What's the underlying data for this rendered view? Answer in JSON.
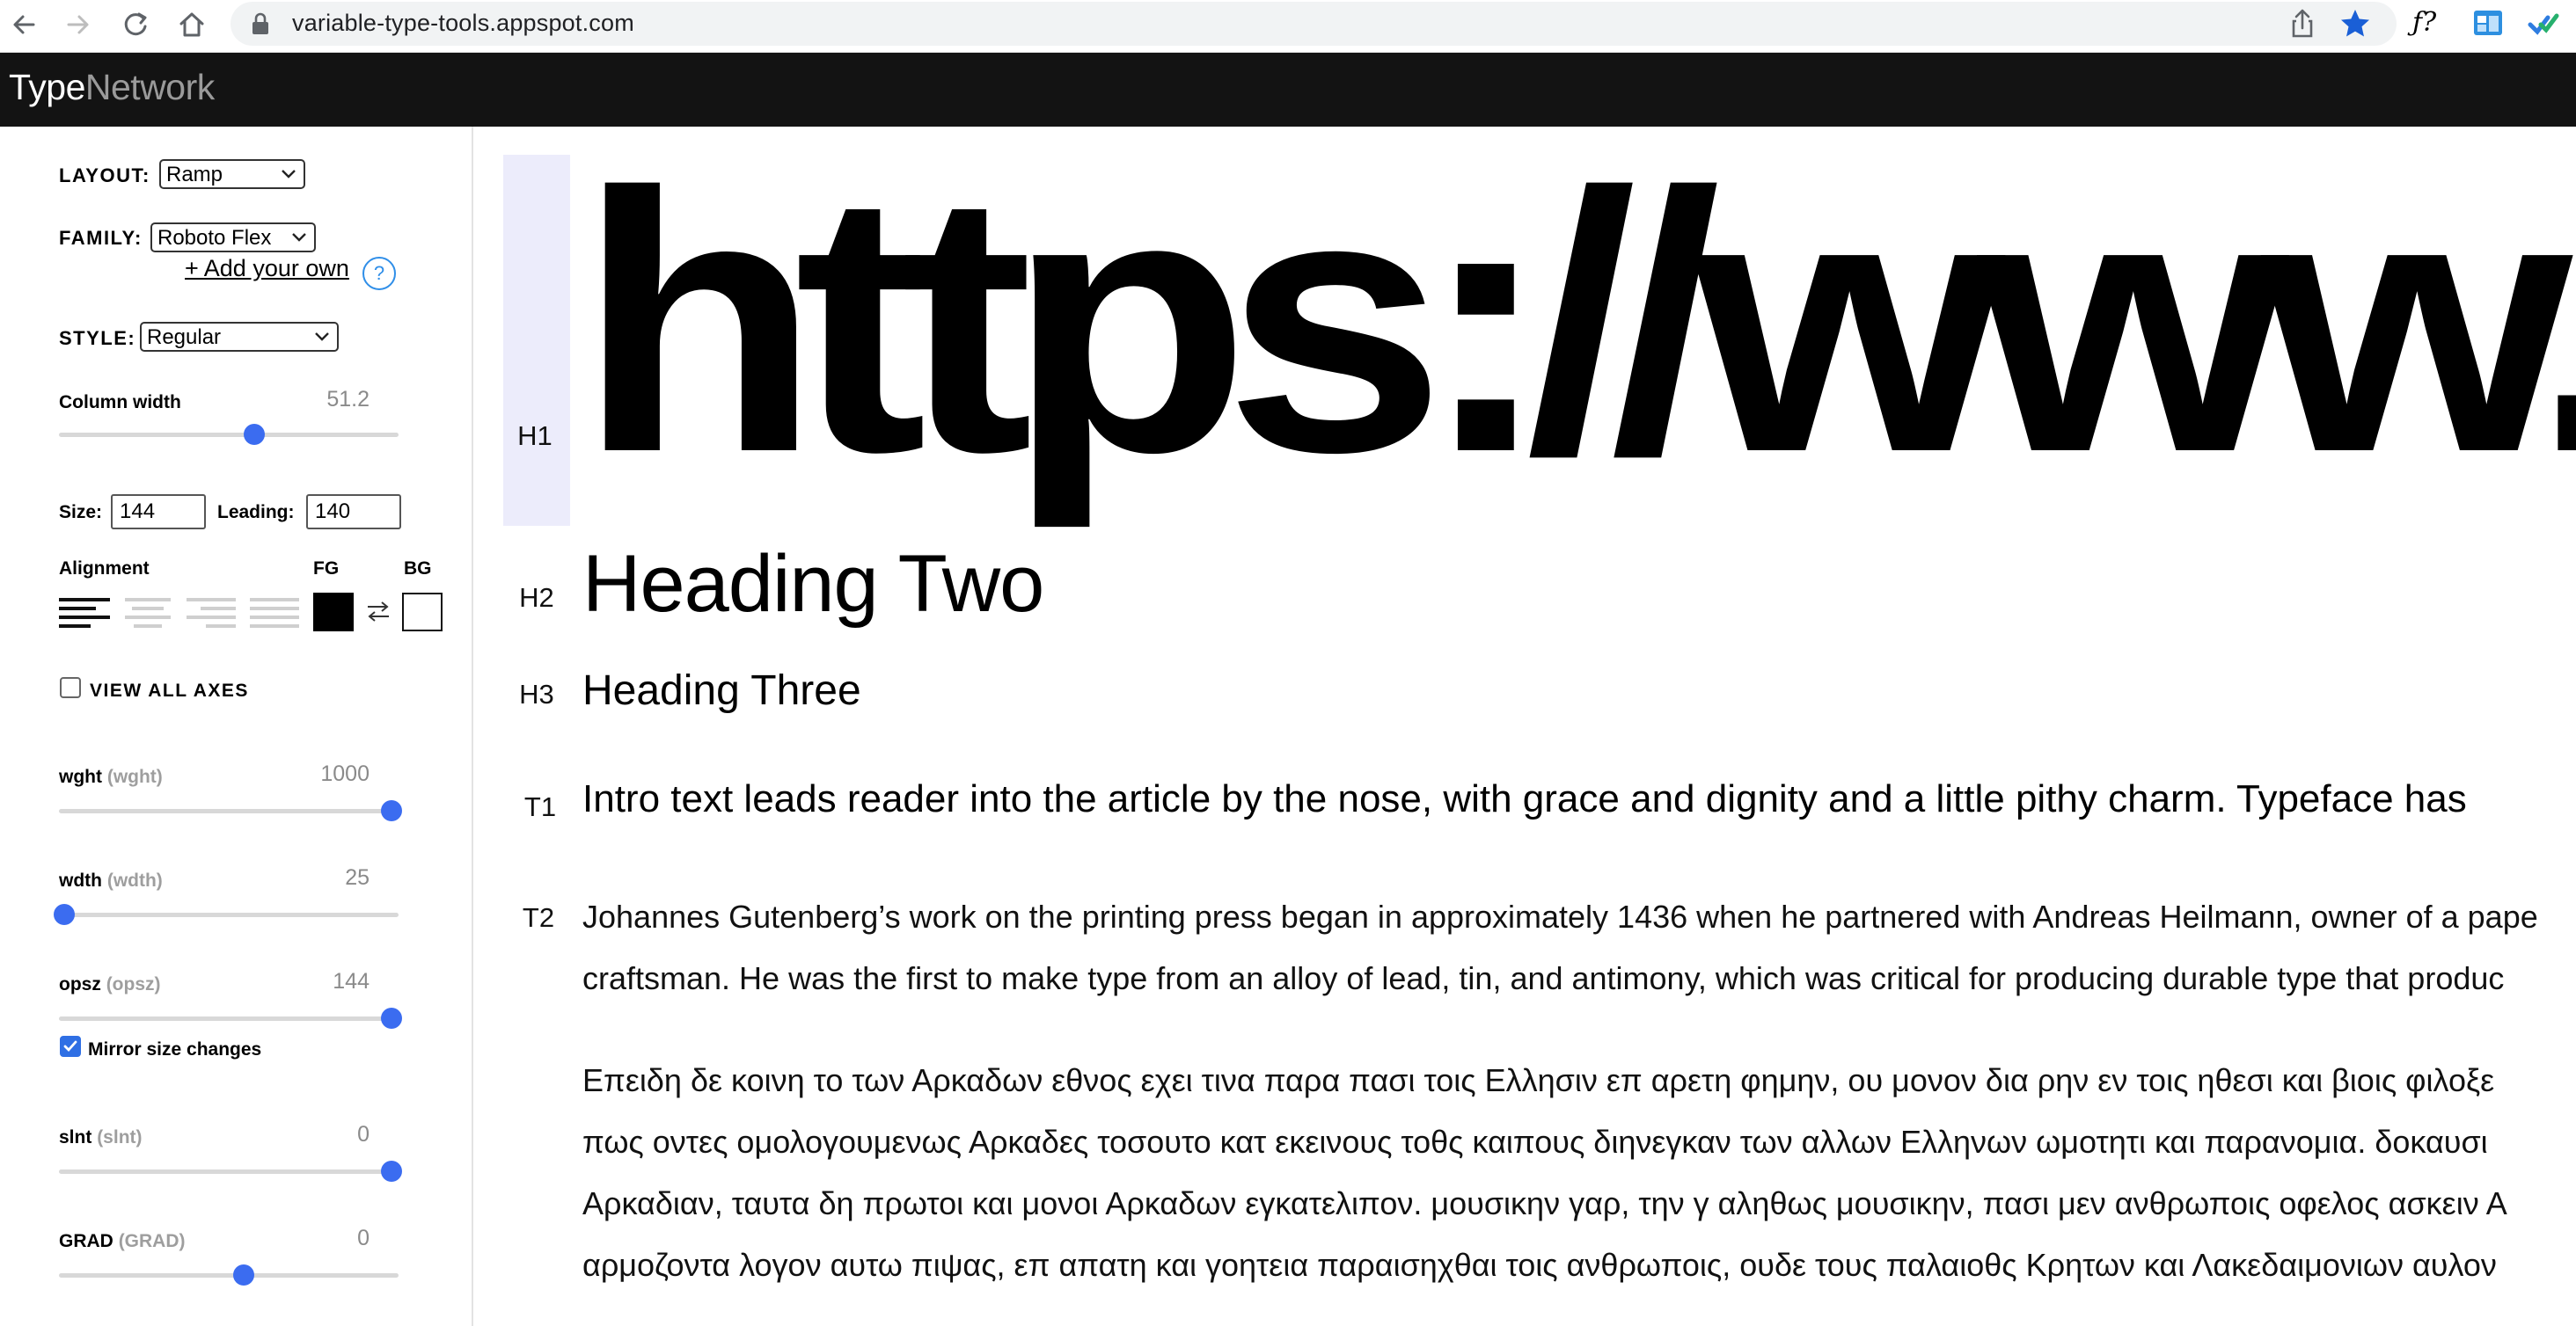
{
  "browser": {
    "url": "variable-type-tools.appspot.com"
  },
  "site": {
    "brand_part1": "Type",
    "brand_part2": "Network"
  },
  "sidebar": {
    "layout": {
      "label": "LAYOUT:",
      "value": "Ramp"
    },
    "family": {
      "label": "FAMILY:",
      "value": "Roboto Flex",
      "add_own": "+ Add your own",
      "help": "?"
    },
    "style": {
      "label": "STYLE:",
      "value": "Regular"
    },
    "column_width": {
      "label": "Column width",
      "value": "51.2",
      "fraction": 0.58
    },
    "size": {
      "label": "Size:",
      "value": "144"
    },
    "leading": {
      "label": "Leading:",
      "value": "140"
    },
    "alignment_label": "Alignment",
    "fg_label": "FG",
    "bg_label": "BG",
    "fg_color": "#000000",
    "bg_color": "#ffffff",
    "view_all_axes": "VIEW ALL AXES",
    "axes": [
      {
        "name": "wght",
        "tag": "(wght)",
        "value": "1000",
        "fraction": 1.0
      },
      {
        "name": "wdth",
        "tag": "(wdth)",
        "value": "25",
        "fraction": 0.0
      },
      {
        "name": "opsz",
        "tag": "(opsz)",
        "value": "144",
        "fraction": 1.0
      },
      {
        "name": "slnt",
        "tag": "(slnt)",
        "value": "0",
        "fraction": 1.0
      },
      {
        "name": "GRAD",
        "tag": "(GRAD)",
        "value": "0",
        "fraction": 0.55
      }
    ],
    "mirror_size": "Mirror size changes"
  },
  "preview": {
    "h1_tag": "H1",
    "h1_text": "https://www.fon",
    "h2_tag": "H2",
    "h2_text": "Heading Two",
    "h3_tag": "H3",
    "h3_text": "Heading Three",
    "t1_tag": "T1",
    "t1_text": "Intro text leads reader into the article by the nose, with grace and dignity and a little pithy charm. Typeface has",
    "t2_tag": "T2",
    "t2_lines": [
      "Johannes Gutenberg’s work on the printing press began in approximately 1436 when he partnered with Andreas Heilmann, owner of a pape",
      "craftsman. He was the first to make type from an alloy of lead, tin, and antimony, which was critical for producing durable type that produc",
      "Επειδη δε κοινη το των Αρκαδων εθνος εχει τινα παρα πασι τοις Ελλησιν επ αρετη φημην, ου μονον δια ρην εν τοις ηθεσι και βιοις φιλοξε",
      "πως οντες ομολογουμενως Αρκαδες τοσουτο κατ εκεινους τοθς καιπους διηνεγκαν των αλλων Ελληνων ωμοτητι και παρανομια. δοκαυσι",
      "Αρκαδιαν, ταυτα δη πρωτοι και μονοι Αρκαδων εγκατελιπον. μουσικην γαρ, την γ αληθως μουσικην, πασι μεν ανθρωποις οφελος ασκειν Α",
      "αρμοζοντα λογον αυτω πιψας, επ απατη και γοητεια παραισηχθαι τοις ανθρωποις, ουδε τους παλαιοθς Κρητων και Λακεδαιμονιων αυλον"
    ]
  }
}
